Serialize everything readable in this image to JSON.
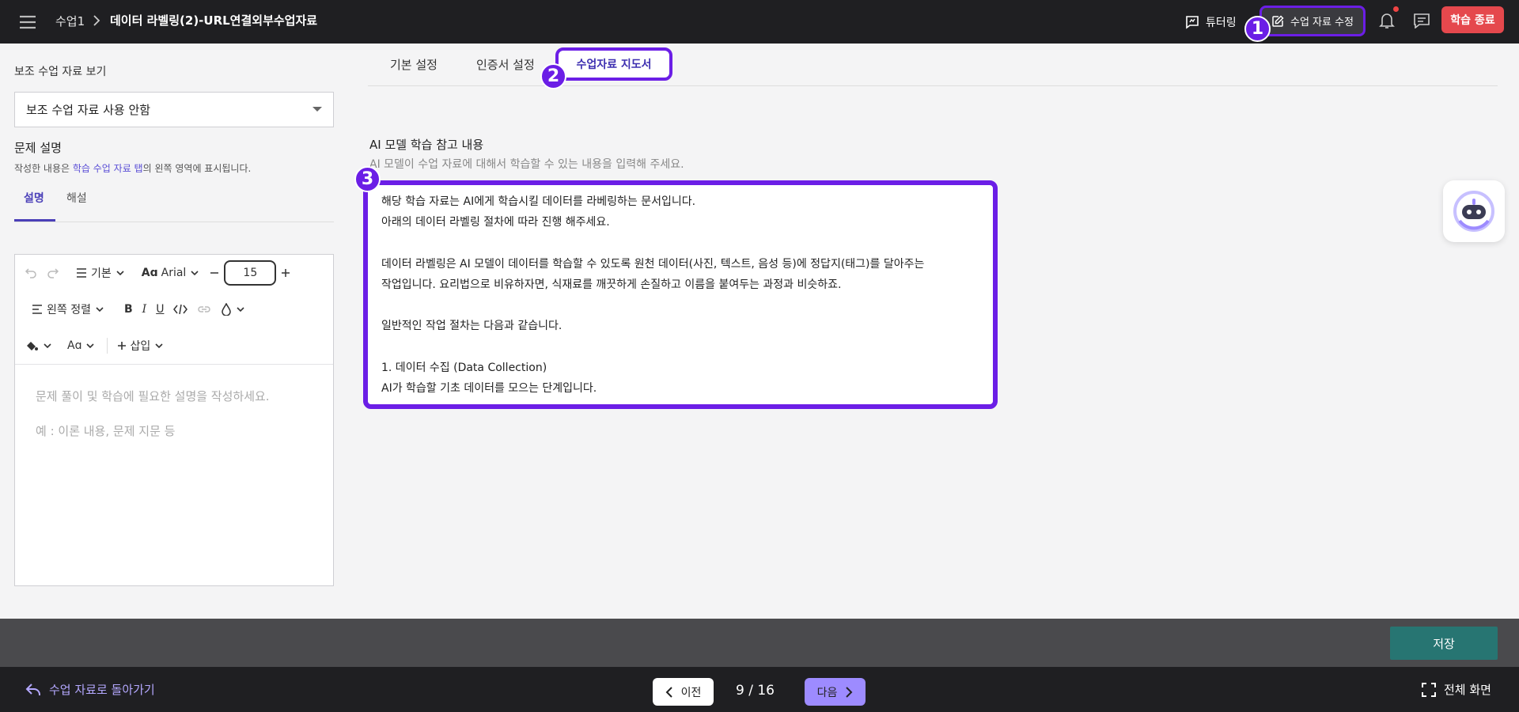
{
  "header": {
    "breadcrumb": [
      "수업1",
      "데이터 라벨링(2)-URL연결외부수업자료"
    ],
    "tutor_label": "튜터링",
    "edit_label": "수업 자료 수정",
    "end_label": "학습 종료",
    "badges": [
      "1",
      "2",
      "3"
    ]
  },
  "left_panel": {
    "title": "보조 수업 자료 보기",
    "select_value": "보조 수업 자료 사용 안함",
    "problem_title": "문제 설명",
    "problem_desc_pre": "작성한 내용은 ",
    "problem_desc_link": "학습 수업 자료 탭",
    "problem_desc_post": "의 왼쪽 영역에 표시됩니다.",
    "tabs": [
      "설명",
      "해설"
    ],
    "toolbar": {
      "style_label": "기본",
      "font_label": "Arial",
      "font_size": "15",
      "align_label": "왼쪽 정렬",
      "insert_label": "삽입"
    },
    "placeholder_lines": [
      "문제 풀이 및 학습에 필요한 설명을 작성하세요.",
      "예 : 이론 내용, 문제 지문 등"
    ]
  },
  "main": {
    "tabs": [
      "기본 설정",
      "인증서 설정",
      "수업자료 지도서"
    ],
    "ai_title": "AI 모델 학습 참고 내용",
    "ai_desc": "AI 모델이 수업 자료에 대해서 학습할 수 있는 내용을 입력해 주세요.",
    "ai_content": [
      "해당 학습 자료는 AI에게 학습시킬 데이터를 라베링하는 문서입니다.",
      "아래의 데이터 라벨링 절차에 따라 진행 해주세요.",
      "",
      "데이터 라벨링은 AI 모델이 데이터를 학습할 수 있도록 원천 데이터(사진, 텍스트, 음성 등)에 정답지(태그)를 달아주는",
      "작업입니다. 요리법으로 비유하자면, 식재료를 깨끗하게 손질하고 이름을 붙여두는 과정과 비슷하죠.",
      "",
      "일반적인 작업 절차는 다음과 같습니다.",
      "",
      "1. 데이터 수집 (Data Collection)",
      "AI가 학습할 기초 데이터를 모으는 단계입니다."
    ]
  },
  "footer": {
    "save_label": "저장",
    "back_label": "수업 자료로 돌아가기",
    "prev_label": "이전",
    "page_indicator": "9 / 16",
    "next_label": "다음",
    "fullscreen_label": "전체 화면"
  },
  "colors": {
    "highlight": "#6b1ee6",
    "end_button": "#e5484d",
    "save_button": "#277572",
    "next_button": "#9d8bff",
    "link": "#5b4fd6"
  }
}
